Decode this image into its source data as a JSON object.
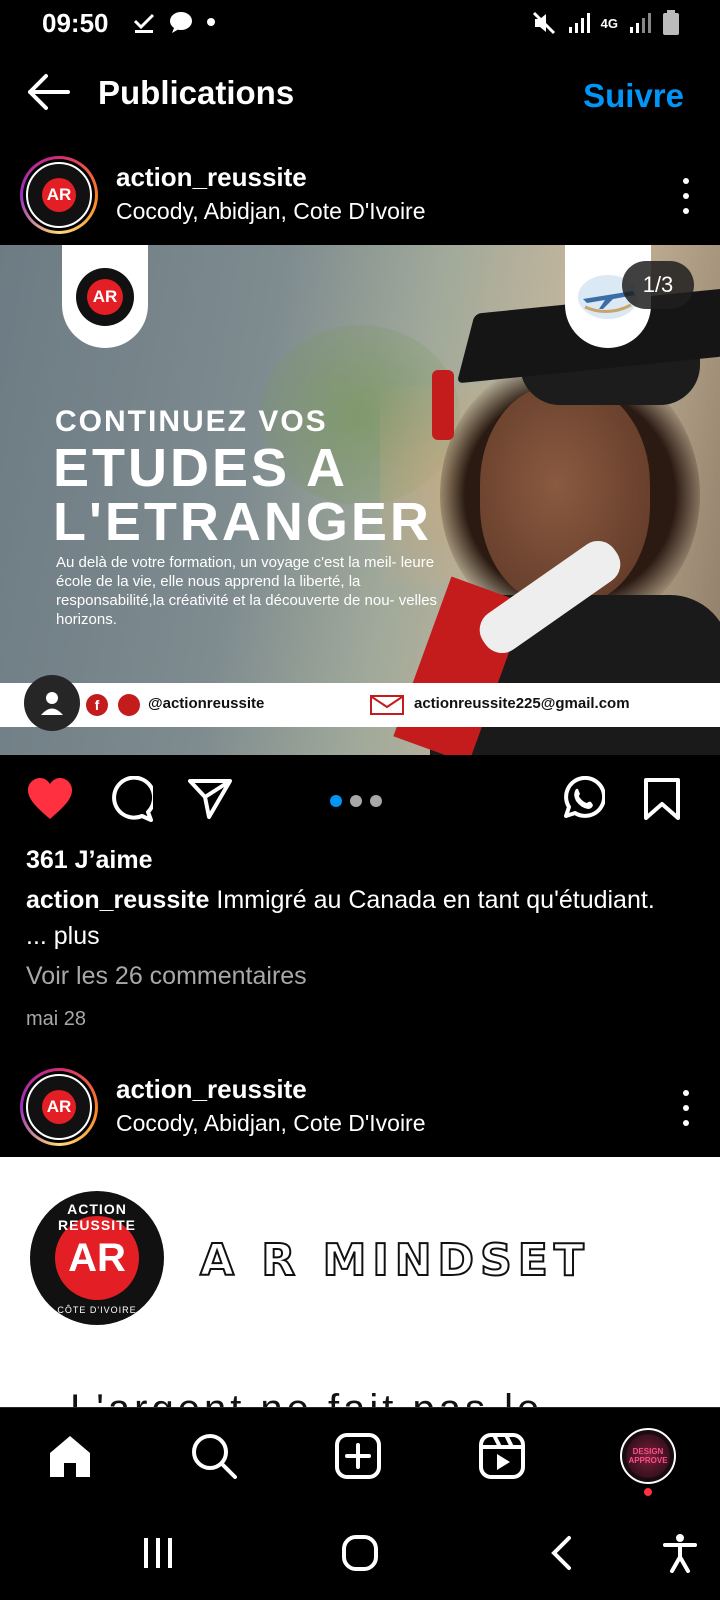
{
  "status_bar": {
    "time": "09:50",
    "network": "4G"
  },
  "app_bar": {
    "title": "Publications",
    "follow_label": "Suivre"
  },
  "post1": {
    "username": "action_reussite",
    "location": "Cocody, Abidjan, Cote D'Ivoire",
    "counter": "1/3",
    "image": {
      "headline_small": "CONTINUEZ VOS",
      "headline_line1": "ETUDES A",
      "headline_line2": "L'ETRANGER",
      "promo_text": "Au delà de votre formation, un voyage c'est la meil- leure école de la vie, elle nous apprend la liberté, la responsabilité,la créativité et la découverte de nou- velles horizons.",
      "social_handle": "@actionreussite",
      "email": "actionreussite225@gmail.com",
      "logo_letters": "AR"
    },
    "likes": "361 J’aime",
    "caption_user": "action_reussite",
    "caption_text": " Immigré au Canada en tant qu'étudiant. ... plus",
    "comments_link": "Voir les 26 commentaires",
    "date": "mai 28"
  },
  "post2": {
    "username": "action_reussite",
    "location": "Cocody, Abidjan, Cote D'Ivoire",
    "image": {
      "logo_top": "ACTION REUSSITE",
      "logo_bottom": "CÔTE D'IVOIRE",
      "logo_letters": "AR",
      "title": "A R MINDSET",
      "cut_text": "L'argent ne fait pas le bonheur, mais"
    }
  },
  "nav_profile_label": "DESIGN APPROVE",
  "colors": {
    "accent": "#0095f6",
    "like": "#ff3040",
    "brand_red": "#e31e24"
  }
}
